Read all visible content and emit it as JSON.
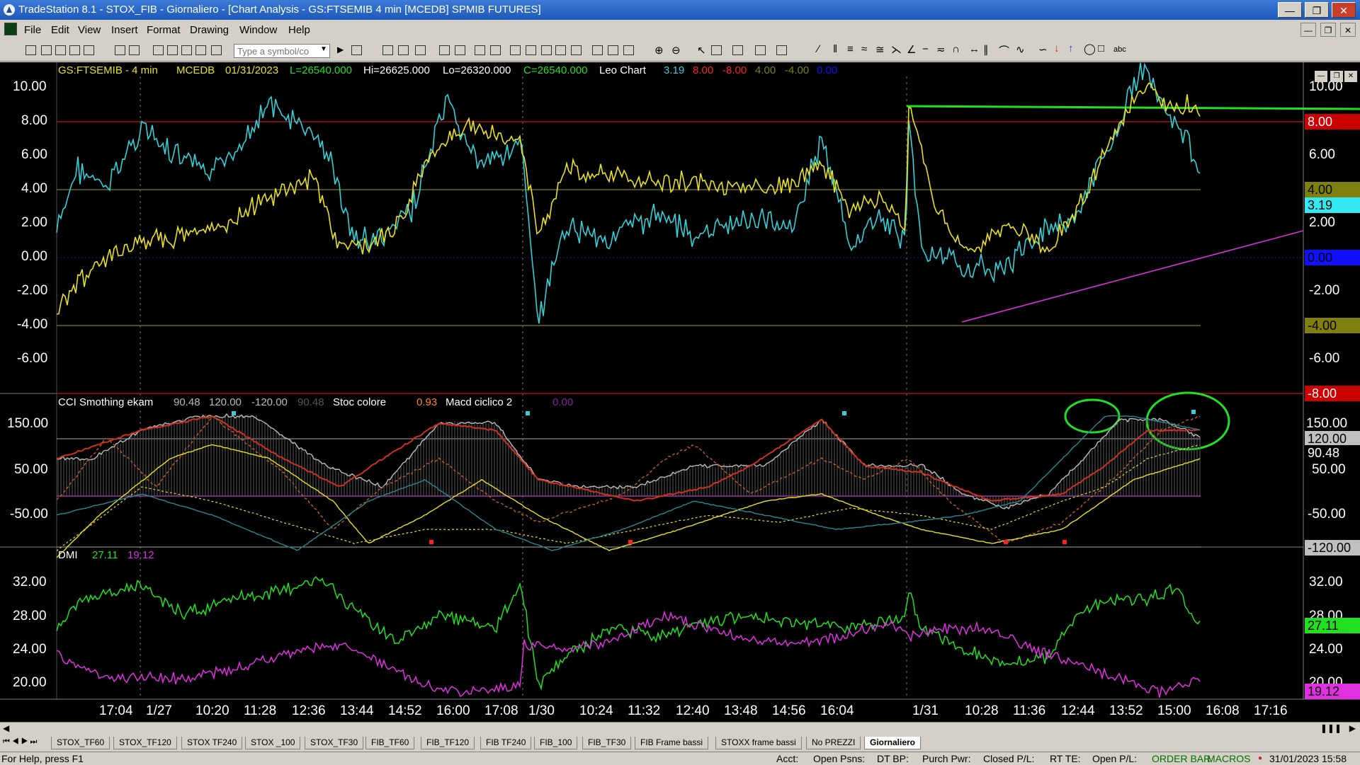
{
  "window": {
    "title": "TradeStation 8.1 - STOX_FIB - Giornaliero - [Chart Analysis - GS:FTSEMIB  4 min  [MCEDB] SPMIB FUTURES]"
  },
  "menu": [
    "File",
    "Edit",
    "View",
    "Insert",
    "Format",
    "Drawing",
    "Window",
    "Help"
  ],
  "toolbar": {
    "symbol_placeholder": "Type a symbol/co",
    "abc_label": "abc"
  },
  "price_panel": {
    "symbol": "GS:FTSEMIB - 4 min",
    "exchange": "MCEDB",
    "date": "01/31/2023",
    "last": "L=26540.000",
    "high": "Hi=26625.000",
    "low": "Lo=26320.000",
    "close": "C=26540.000",
    "indicator": "Leo Chart",
    "values": [
      "3.19",
      "8.00",
      "-8.00",
      "4.00",
      "-4.00",
      "0.00"
    ],
    "y_ticks": [
      "10.00",
      "8.00",
      "6.00",
      "4.00",
      "2.00",
      "0.00",
      "-2.00",
      "-4.00",
      "-6.00"
    ],
    "right_ticks": [
      "10.00",
      "6.00",
      "2.00",
      "-2.00",
      "-6.00"
    ],
    "tags": [
      "8.00",
      "4.00",
      "3.19",
      "0.00",
      "-4.00",
      "-8.00"
    ]
  },
  "cci_panel": {
    "name": "CCI Smothing ekam",
    "values": [
      "90.48",
      "120.00",
      "-120.00",
      "90.48"
    ],
    "stoc": "Stoc colore",
    "stoc_value": "0.93",
    "macd": "Macd ciclico 2",
    "macd_value": "0.00",
    "y_ticks": [
      "150.00",
      "50.00",
      "-50.00"
    ],
    "right_ticks": [
      "150.00",
      "50.00",
      "-50.00"
    ],
    "tags": [
      "120.00",
      "90.48",
      "-120.00"
    ]
  },
  "dmi_panel": {
    "name": "DMI",
    "plus": "27.11",
    "minus": "19.12",
    "y_ticks": [
      "32.00",
      "28.00",
      "24.00",
      "20.00"
    ],
    "right_ticks": [
      "32.00",
      "28.00",
      "24.00",
      "20.00"
    ],
    "tags": [
      "27.11",
      "19.12"
    ]
  },
  "time_axis": [
    "17:04",
    "1/27",
    "10:20",
    "11:28",
    "12:36",
    "13:44",
    "14:52",
    "16:00",
    "17:08",
    "1/30",
    "10:24",
    "11:32",
    "12:40",
    "13:48",
    "14:56",
    "16:04",
    "1/31",
    "10:28",
    "11:36",
    "12:44",
    "13:52",
    "15:00",
    "16:08",
    "17:16"
  ],
  "workspace_tabs": [
    "STOX_TF60",
    "STOX_TF120",
    "STOX TF240",
    "STOX _100",
    "STOX_TF30",
    "FIB_TF60",
    "FIB_TF120",
    "FIB TF240",
    "FIB_100",
    "FIB_TF30",
    "FIB Frame bassi",
    "STOXX frame bassi",
    "No PREZZI",
    "Giornaliero"
  ],
  "status": {
    "help": "For Help, press F1",
    "acct": "Acct:",
    "open_psns": "Open Psns:",
    "dt_bp": "DT BP:",
    "purch_pwr": "Purch Pwr:",
    "closed_pl": "Closed P/L:",
    "rt_te": "RT TE:",
    "open_pl": "Open P/L:",
    "order_bar": "ORDER BAR",
    "macros": "MACROS",
    "datetime": "31/01/2023 15:58"
  },
  "colors": {
    "cyan": "#33d0d8",
    "yellow": "#e8e020",
    "red": "#ff2020",
    "green": "#20e020",
    "magenta": "#e030e0",
    "olive": "#808010",
    "blue": "#1010ff"
  }
}
